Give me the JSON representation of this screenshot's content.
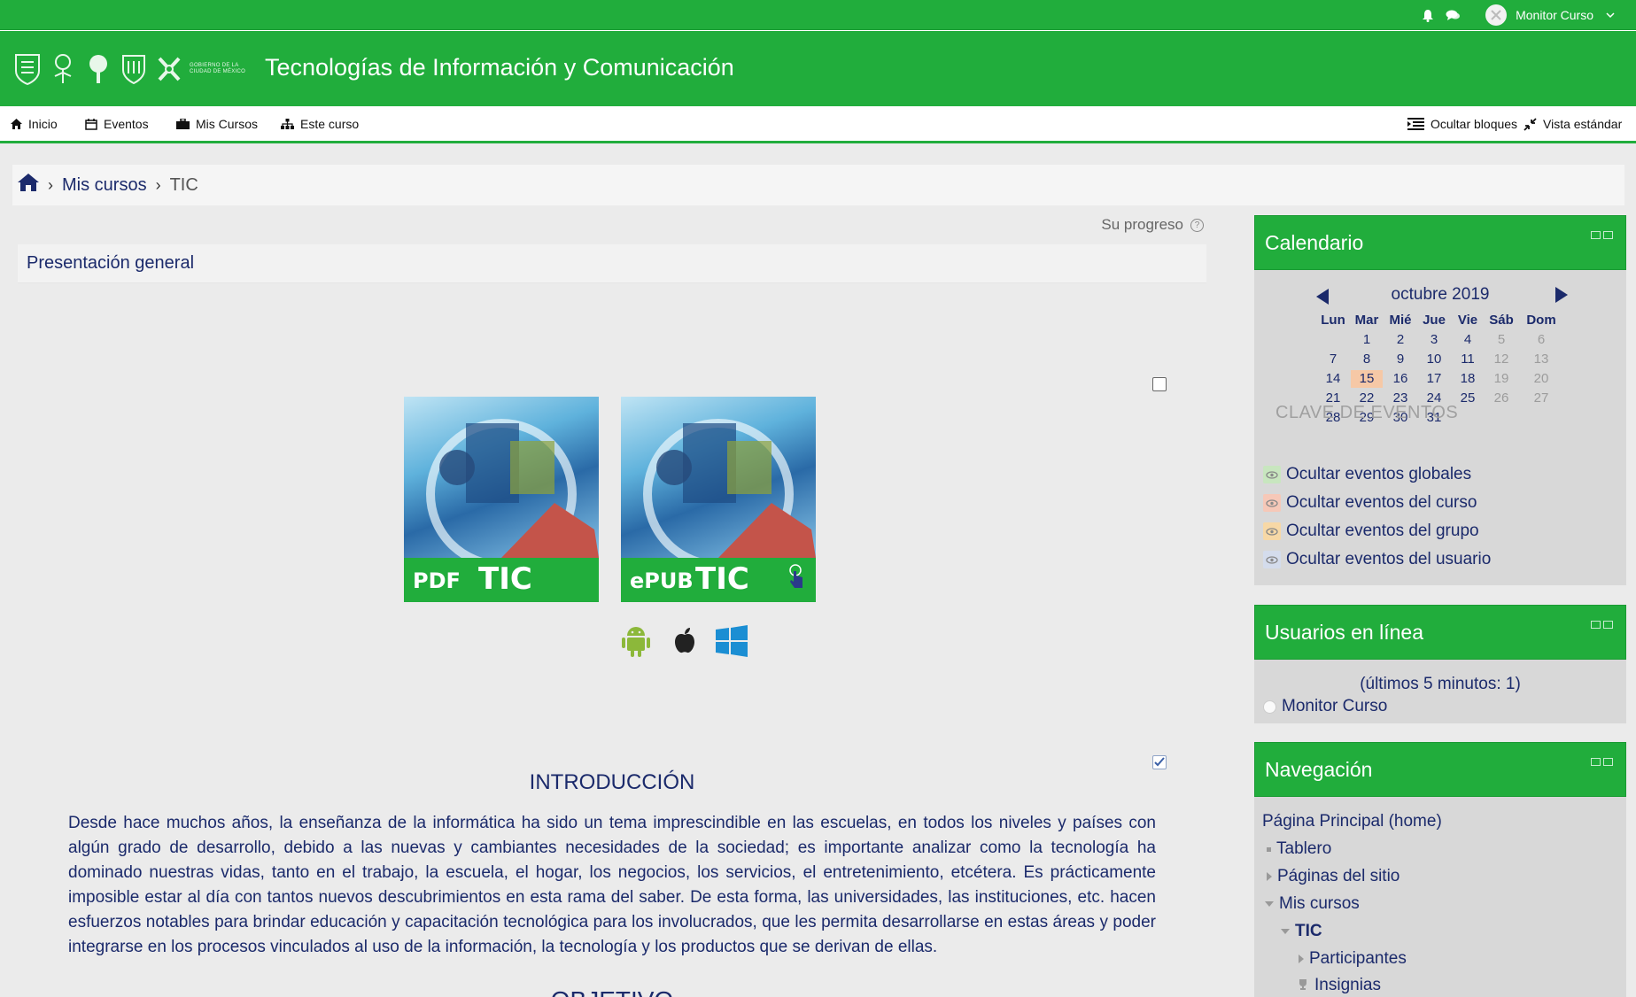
{
  "topbar": {
    "user_name": "Monitor Curso",
    "icons": [
      "bell-icon",
      "chat-icon",
      "chevron-down-icon"
    ]
  },
  "header": {
    "logo_text": "GOBIERNO DE LA CIUDAD DE MÉXICO",
    "title": "Tecnologías de Información y Comunicación"
  },
  "navbar": {
    "items": [
      {
        "label": "Inicio",
        "icon": "home-icon"
      },
      {
        "label": "Eventos",
        "icon": "calendar-icon"
      },
      {
        "label": "Mis Cursos",
        "icon": "briefcase-icon"
      },
      {
        "label": "Este curso",
        "icon": "sitemap-icon"
      }
    ],
    "right": [
      {
        "label": "Ocultar bloques",
        "icon": "list-icon"
      },
      {
        "label": "Vista estándar",
        "icon": "compress-icon"
      }
    ]
  },
  "breadcrumb": {
    "items": [
      "Mis cursos",
      "TIC"
    ]
  },
  "progress": {
    "label": "Su progreso",
    "help": "?"
  },
  "section": {
    "title": "Presentación general",
    "books": [
      {
        "format": "PDF",
        "label": "TIC"
      },
      {
        "format": "ePUB",
        "label": "TIC"
      }
    ],
    "platform_icons": [
      "android-icon",
      "apple-icon",
      "windows-icon"
    ],
    "intro_title": "INTRODUCCIÓN",
    "intro_text": "Desde hace muchos años, la enseñanza de la informática ha sido un tema imprescindible en las escuelas, en todos los niveles y países con algún grado de desarrollo, debido a las nuevas y cambiantes necesidades de la sociedad; es importante analizar como la tecnología ha dominado nuestras vidas, tanto en el trabajo, la escuela, el hogar, los negocios, los servicios, el entretenimiento, etcétera. Es prácticamente imposible estar al día con tantos nuevos descubrimientos en esta rama del saber. De esta forma, las universidades, las instituciones, etc. hacen esfuerzos notables para brindar educación y capacitación tecnológica para los involucrados, que les permita desarrollarse en estas áreas y poder integrarse en los procesos vinculados al uso de la información, la tecnología y los productos que se derivan de ellas.",
    "next_title": "OBJETIVO"
  },
  "calendar": {
    "title": "Calendario",
    "month": "octubre 2019",
    "weekdays": [
      "Lun",
      "Mar",
      "Mié",
      "Jue",
      "Vie",
      "Sáb",
      "Dom"
    ],
    "weeks": [
      [
        "",
        "1",
        "2",
        "3",
        "4",
        "5",
        "6"
      ],
      [
        "7",
        "8",
        "9",
        "10",
        "11",
        "12",
        "13"
      ],
      [
        "14",
        "15",
        "16",
        "17",
        "18",
        "19",
        "20"
      ],
      [
        "21",
        "22",
        "23",
        "24",
        "25",
        "26",
        "27"
      ],
      [
        "28",
        "29",
        "30",
        "31",
        "",
        "",
        ""
      ]
    ],
    "today": "15",
    "key_title": "CLAVE DE EVENTOS",
    "keys": [
      {
        "label": "Ocultar eventos globales",
        "color": "#c8e6bf"
      },
      {
        "label": "Ocultar eventos del curso",
        "color": "#f6c8b8"
      },
      {
        "label": "Ocultar eventos del grupo",
        "color": "#f7d8a6"
      },
      {
        "label": "Ocultar eventos del usuario",
        "color": "#d4dcec"
      }
    ]
  },
  "online_users": {
    "title": "Usuarios en línea",
    "count_text": "(últimos 5 minutos: 1)",
    "user": "Monitor Curso"
  },
  "navigation": {
    "title": "Navegación",
    "home": "Página Principal (home)",
    "items": [
      {
        "label": "Tablero",
        "marker": "bullet"
      },
      {
        "label": "Páginas del sitio",
        "marker": "collapsed"
      },
      {
        "label": "Mis cursos",
        "marker": "expanded"
      },
      {
        "label": "TIC",
        "marker": "expanded"
      },
      {
        "label": "Participantes",
        "marker": "collapsed"
      },
      {
        "label": "Insignias",
        "marker": "trophy"
      }
    ]
  },
  "colors": {
    "brand_green": "#21ad3c",
    "link_navy": "#1b2a6b",
    "today_highlight": "#f6c8a6"
  }
}
